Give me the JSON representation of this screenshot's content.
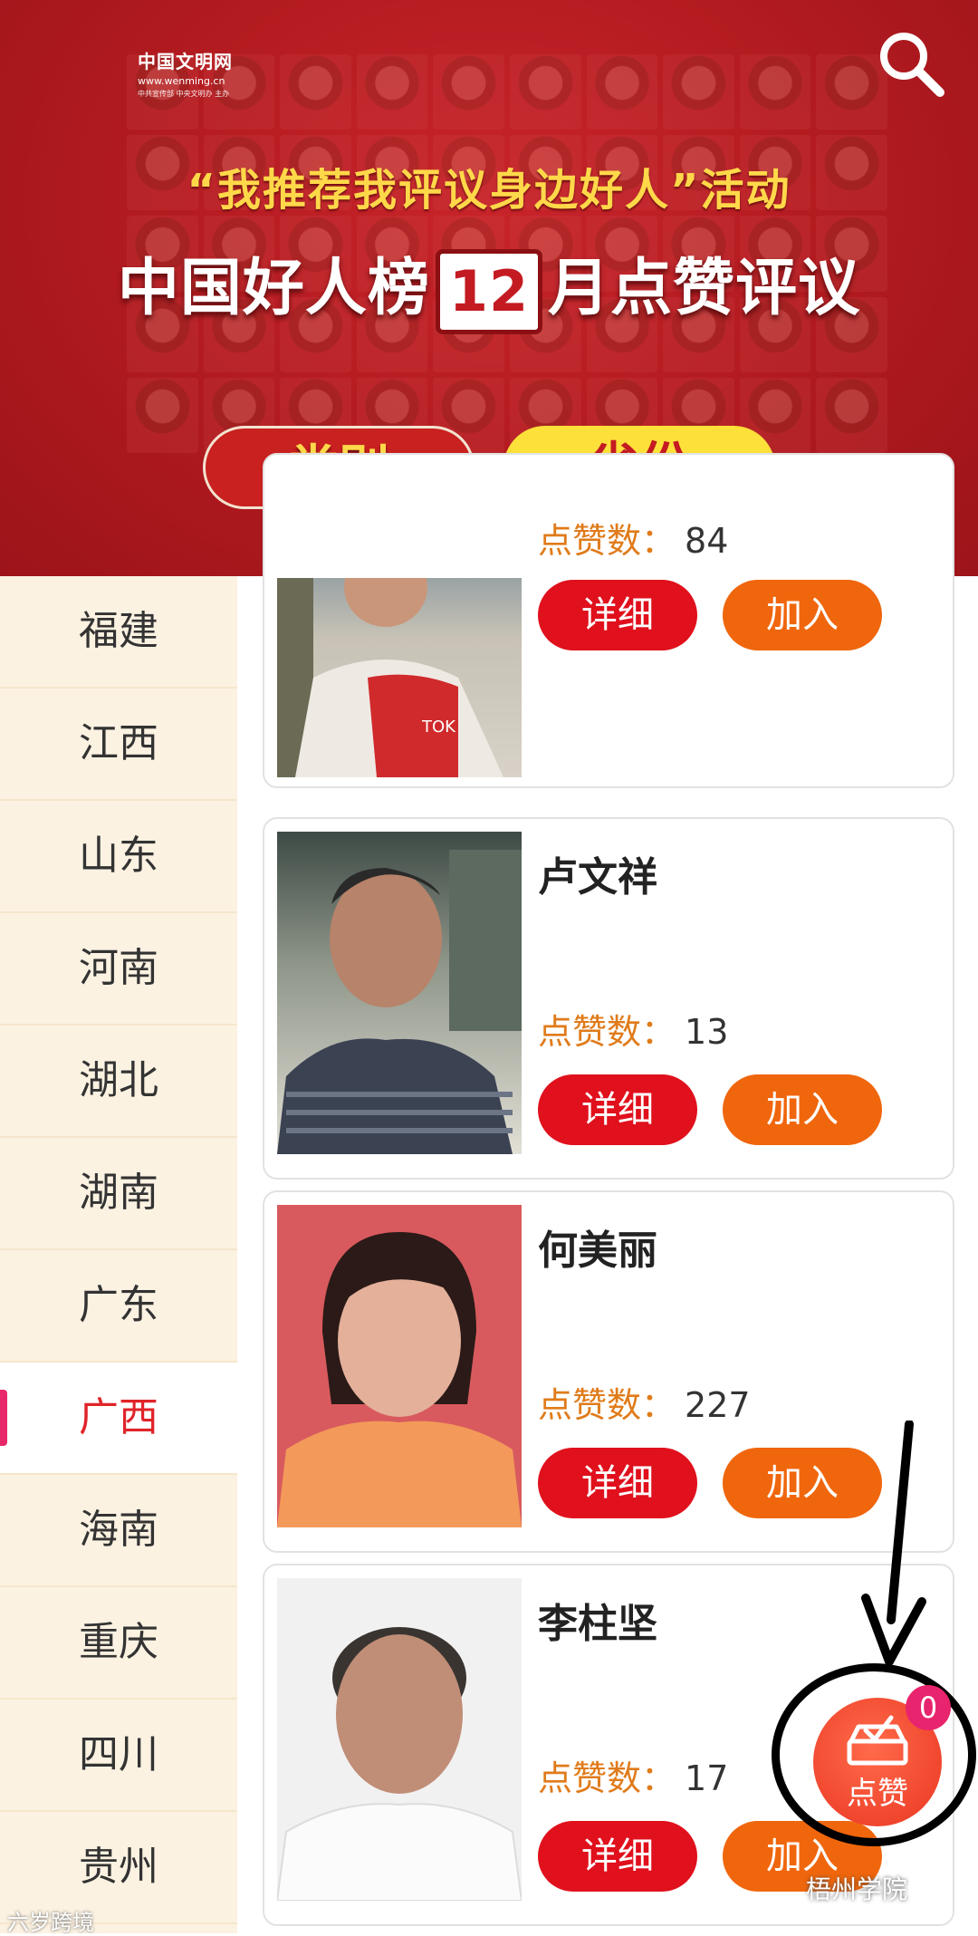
{
  "header": {
    "logo_name": "中国文明网",
    "logo_url": "www.wenming.cn",
    "logo_sub": "中共宣传部  中央文明办  主办",
    "subtitle": "“我推荐我评议身边好人”活动",
    "title_prefix": "中国好人榜",
    "title_month": "12",
    "title_suffix": "月点赞评议",
    "category_button": "类别",
    "province_button": "省份",
    "search_icon": "search-icon"
  },
  "sidebar": {
    "provinces": [
      "福建",
      "江西",
      "山东",
      "河南",
      "湖北",
      "湖南",
      "广东",
      "广西",
      "海南",
      "重庆",
      "四川",
      "贵州"
    ],
    "active": "广西"
  },
  "cards": [
    {
      "name": "",
      "likes_label": "点赞数：",
      "likes": "84",
      "detail": "详细",
      "join": "加入"
    },
    {
      "name": "卢文祥",
      "likes_label": "点赞数：",
      "likes": "13",
      "detail": "详细",
      "join": "加入"
    },
    {
      "name": "何美丽",
      "likes_label": "点赞数：",
      "likes": "227",
      "detail": "详细",
      "join": "加入"
    },
    {
      "name": "李柱坚",
      "likes_label": "点赞数：",
      "likes": "17",
      "detail": "详细",
      "join": "加入"
    }
  ],
  "fab": {
    "label": "点赞",
    "badge": "0",
    "icon": "vote-box-icon"
  },
  "watermarks": {
    "left": "六岁跨境",
    "right": "梧州学院"
  },
  "colors": {
    "banner": "#c41b22",
    "accent": "#e0101c",
    "join": "#f0660c",
    "likes_label": "#e07b1a"
  }
}
